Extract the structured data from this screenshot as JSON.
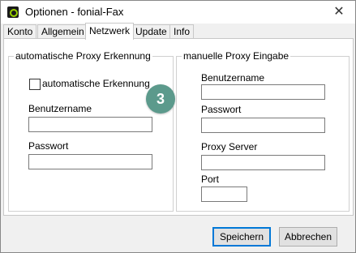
{
  "window": {
    "title": "Optionen - fonial-Fax",
    "close_glyph": "✕"
  },
  "tabs": [
    {
      "label": "Konto",
      "active": false
    },
    {
      "label": "Allgemein",
      "active": false
    },
    {
      "label": "Netzwerk",
      "active": true
    },
    {
      "label": "Update",
      "active": false
    },
    {
      "label": "Info",
      "active": false
    }
  ],
  "step_badge": "3",
  "auto_proxy": {
    "legend": "automatische Proxy Erkennung",
    "checkbox_label": "automatische Erkennung",
    "checkbox_checked": false,
    "username_label": "Benutzername",
    "username_value": "",
    "password_label": "Passwort",
    "password_value": ""
  },
  "manual_proxy": {
    "legend": "manuelle Proxy Eingabe",
    "username_label": "Benutzername",
    "username_value": "",
    "password_label": "Passwort",
    "password_value": "",
    "server_label": "Proxy Server",
    "server_value": "",
    "port_label": "Port",
    "port_value": ""
  },
  "buttons": {
    "save": "Speichern",
    "cancel": "Abbrechen"
  },
  "colors": {
    "badge": "#5c9a8c",
    "primary_border": "#0078d7"
  }
}
